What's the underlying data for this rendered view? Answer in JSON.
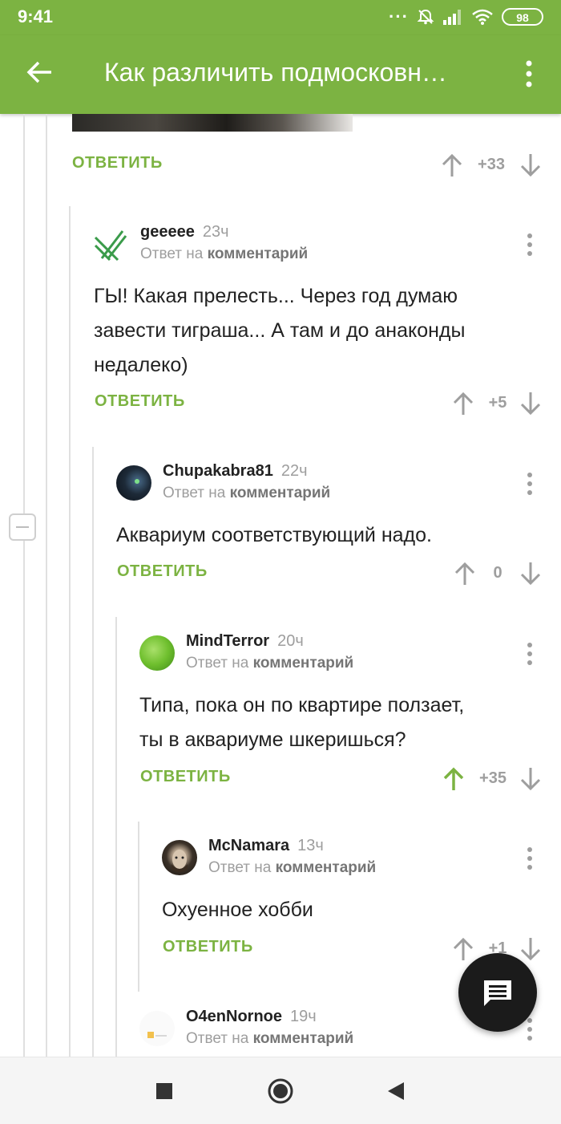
{
  "status_bar": {
    "time": "9:41",
    "battery": "98",
    "dots": "···"
  },
  "app_bar": {
    "title": "Как различить подмосковн…"
  },
  "colors": {
    "accent": "#7cb342",
    "text": "#222222",
    "muted": "#9e9e9e"
  },
  "top_action": {
    "reply_label": "ОТВЕТИТЬ",
    "score": "+33"
  },
  "comments": [
    {
      "username": "geeeee",
      "time": "23ч",
      "reply_prefix": "Ответ на",
      "reply_target": "комментарий",
      "text": [
        "ГЫ! Какая прелесть... Через год думаю",
        "завести тиграша... А там и до анаконды",
        "недалеко)"
      ],
      "reply_label": "ОТВЕТИТЬ",
      "score": "+5"
    },
    {
      "username": "Chupakabra81",
      "time": "22ч",
      "reply_prefix": "Ответ на",
      "reply_target": "комментарий",
      "text": [
        "Аквариум соответствующий надо."
      ],
      "reply_label": "ОТВЕТИТЬ",
      "score": "0"
    },
    {
      "username": "MindTerror",
      "time": "20ч",
      "reply_prefix": "Ответ на",
      "reply_target": "комментарий",
      "text": [
        "Типа, пока он по квартире ползает,",
        "ты в аквариуме шкеришься?"
      ],
      "reply_label": "ОТВЕТИТЬ",
      "score": "+35"
    },
    {
      "username": "McNamara",
      "time": "13ч",
      "reply_prefix": "Ответ на",
      "reply_target": "комментарий",
      "text": [
        "Охуенное хобби"
      ],
      "reply_label": "ОТВЕТИТЬ",
      "score": "+1"
    },
    {
      "username": "O4enNornoe",
      "time": "19ч",
      "reply_prefix": "Ответ на",
      "reply_target": "комментарий"
    }
  ]
}
